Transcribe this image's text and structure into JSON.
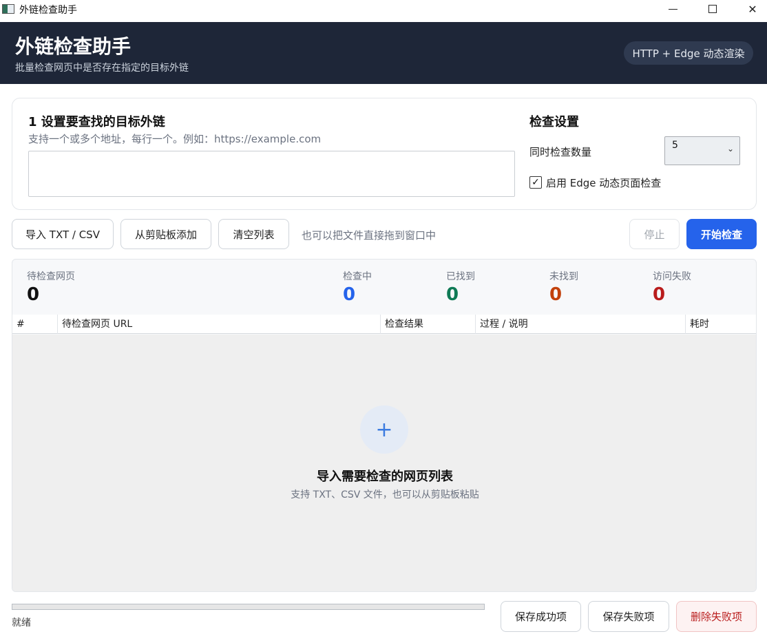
{
  "window": {
    "title": "外链检查助手"
  },
  "header": {
    "title": "外链检查助手",
    "subtitle": "批量检查网页中是否存在指定的目标外链",
    "badge": "HTTP + Edge 动态渲染"
  },
  "target": {
    "step_title": "1  设置要查找的目标外链",
    "hint": "支持一个或多个地址，每行一个。例如：https://example.com",
    "value": ""
  },
  "settings": {
    "title": "检查设置",
    "concurrency_label": "同时检查数量",
    "concurrency_value": "5",
    "edge_label": "启用 Edge 动态页面检查",
    "edge_checked": true
  },
  "toolbar": {
    "import_label": "导入 TXT / CSV",
    "clipboard_label": "从剪贴板添加",
    "clear_label": "清空列表",
    "drop_hint": "也可以把文件直接拖到窗口中",
    "stop_label": "停止",
    "start_label": "开始检查"
  },
  "stats": {
    "pending": {
      "label": "待检查网页",
      "value": "0"
    },
    "checking": {
      "label": "检查中",
      "value": "0"
    },
    "found": {
      "label": "已找到",
      "value": "0"
    },
    "not_found": {
      "label": "未找到",
      "value": "0"
    },
    "failed": {
      "label": "访问失败",
      "value": "0"
    }
  },
  "table": {
    "columns": [
      "#",
      "待检查网页 URL",
      "检查结果",
      "过程 / 说明",
      "耗时"
    ],
    "rows": []
  },
  "empty_state": {
    "icon": "plus-icon",
    "title": "导入需要检查的网页列表",
    "hint": "支持 TXT、CSV 文件，也可以从剪贴板粘贴"
  },
  "footer": {
    "progress": 0,
    "status": "就绪",
    "save_success_label": "保存成功项",
    "save_failed_label": "保存失败项",
    "delete_failed_label": "删除失败项"
  },
  "colors": {
    "header_bg": "#1e2638",
    "accent": "#2563eb",
    "found": "#0f7a55",
    "not_found": "#c2410c",
    "failed": "#b91c1c"
  }
}
